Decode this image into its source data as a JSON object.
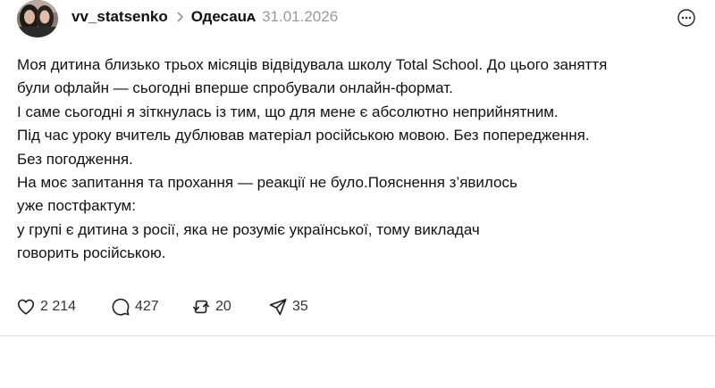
{
  "post": {
    "author": "vv_statsenko",
    "community": "Одесаuᴀ",
    "date": "31.01.2026",
    "text_lines": [
      "Моя дитина близько трьох місяців відвідувала школу Total School. До цього заняття",
      "були офлайн — сьогодні вперше спробували онлайн-формат.",
      "І саме сьогодні я зіткнулась із тим, що для мене є абсолютно неприйнятним.",
      "Під час уроку вчитель дублював матеріал російською мовою. Без попередження.",
      "Без погодження.",
      "На моє запитання та прохання — реакції не було.Пояснення з’явилось",
      "уже постфактум:",
      "у групі є дитина з росії, яка не розуміє української, тому викладач",
      "говорить російською."
    ],
    "actions": {
      "likes": "2 214",
      "comments": "427",
      "reposts": "20",
      "shares": "35"
    },
    "icons": {
      "avatar": "avatar-photo",
      "separator": "chevron-right-icon",
      "more": "more-dots-icon",
      "like": "heart-icon",
      "comment": "comment-bubble-icon",
      "repost": "repost-icon",
      "share": "send-icon"
    }
  }
}
